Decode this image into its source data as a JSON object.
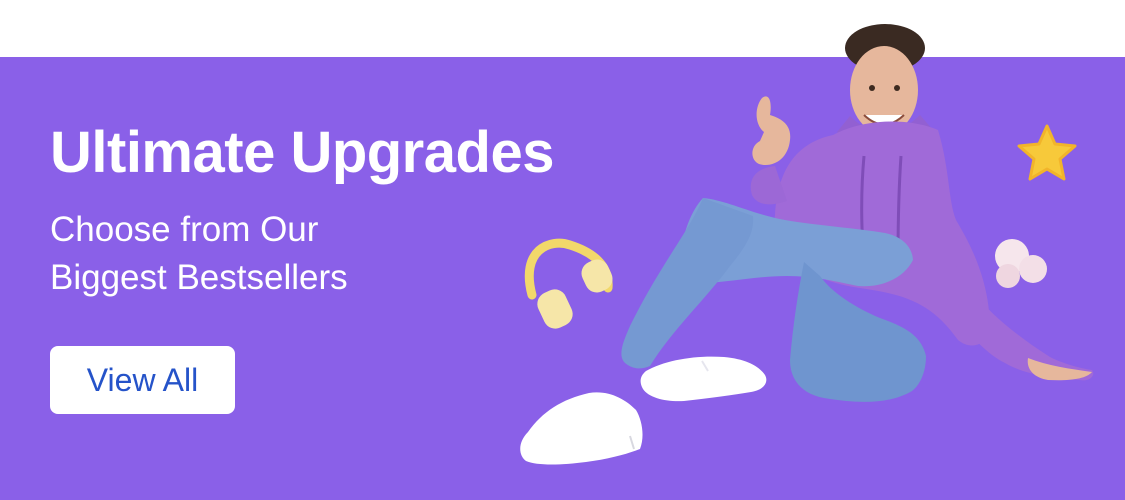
{
  "banner": {
    "headline": "Ultimate Upgrades",
    "subheadline_line1": "Choose from Our",
    "subheadline_line2": "Biggest Bestsellers",
    "cta_label": "View All"
  },
  "colors": {
    "banner_background": "#8a60e8",
    "headline_text": "#ffffff",
    "cta_background": "#ffffff",
    "cta_text": "#2553c9",
    "hoodie": "#a06ad8",
    "jeans": "#7b9fd6",
    "star": "#f7c93a",
    "headphones": "#f2d86a"
  },
  "icons": [
    "headphones-icon",
    "star-icon",
    "cloud-icon"
  ]
}
